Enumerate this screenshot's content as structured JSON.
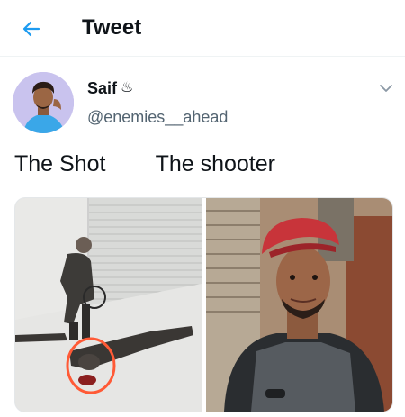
{
  "header": {
    "back_icon": "arrow-left-icon",
    "title": "Tweet",
    "accent_color": "#1d9bf0"
  },
  "author": {
    "display_name": "Saif",
    "name_emoji": "♨",
    "handle": "@enemies__ahead",
    "menu_icon": "chevron-down-icon"
  },
  "tweet": {
    "text": "The Shot        The shooter"
  },
  "media": {
    "count": 2,
    "items": [
      {
        "name": "photo-shot",
        "highlight_color": "#ff5a36"
      },
      {
        "name": "photo-shooter"
      }
    ]
  }
}
